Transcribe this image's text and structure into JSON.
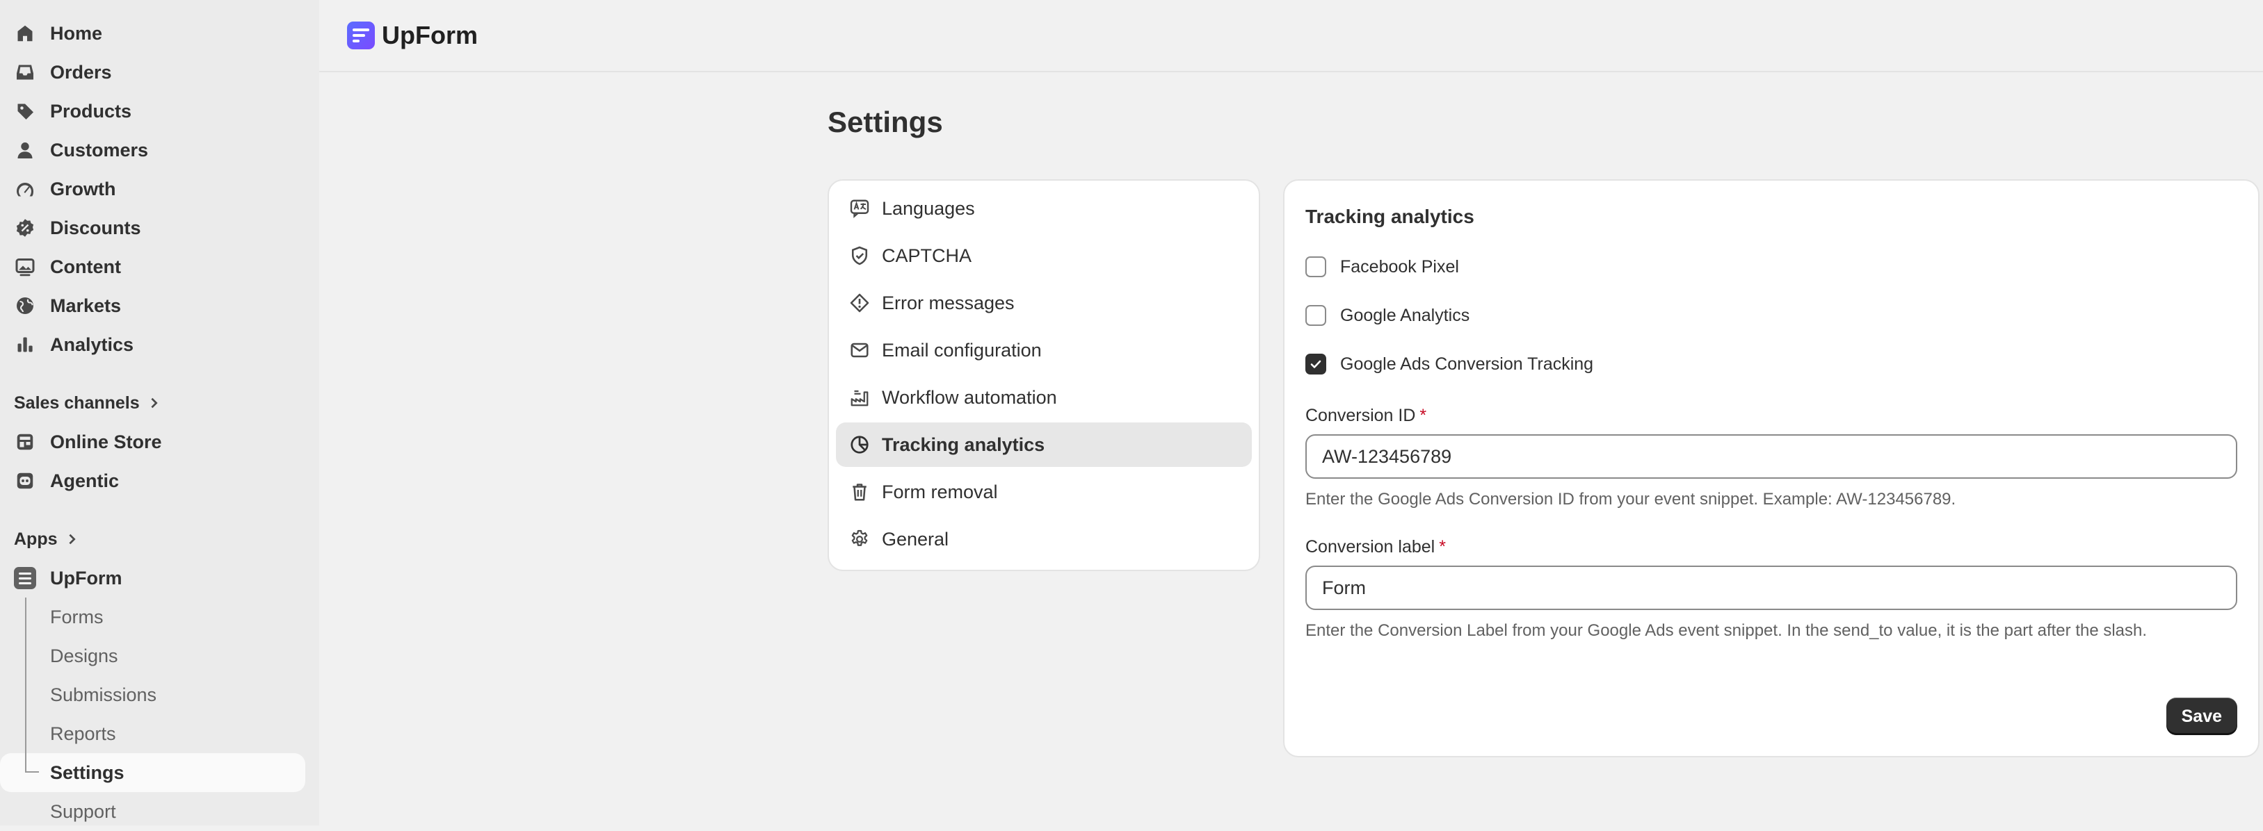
{
  "sidebar": {
    "items": [
      {
        "label": "Home",
        "icon": "home-icon"
      },
      {
        "label": "Orders",
        "icon": "inbox-icon"
      },
      {
        "label": "Products",
        "icon": "tag-icon"
      },
      {
        "label": "Customers",
        "icon": "person-icon"
      },
      {
        "label": "Growth",
        "icon": "gauge-icon"
      },
      {
        "label": "Discounts",
        "icon": "discount-icon"
      },
      {
        "label": "Content",
        "icon": "image-icon"
      },
      {
        "label": "Markets",
        "icon": "globe-icon"
      },
      {
        "label": "Analytics",
        "icon": "bar-chart-icon"
      }
    ],
    "sales_channels_label": "Sales channels",
    "channels": [
      {
        "label": "Online Store",
        "icon": "store-icon"
      },
      {
        "label": "Agentic",
        "icon": "robot-icon"
      }
    ],
    "apps_label": "Apps",
    "app": {
      "label": "UpForm",
      "icon": "upform-app-icon"
    },
    "app_sub_items": [
      {
        "label": "Forms"
      },
      {
        "label": "Designs"
      },
      {
        "label": "Submissions"
      },
      {
        "label": "Reports"
      },
      {
        "label": "Settings",
        "active": true
      },
      {
        "label": "Support"
      }
    ]
  },
  "header": {
    "brand": "UpForm",
    "brand_icon": "upform-logo-icon"
  },
  "page": {
    "title": "Settings"
  },
  "settings_menu": {
    "items": [
      {
        "label": "Languages",
        "icon": "translate-icon"
      },
      {
        "label": "CAPTCHA",
        "icon": "shield-check-icon"
      },
      {
        "label": "Error messages",
        "icon": "alert-diamond-icon"
      },
      {
        "label": "Email configuration",
        "icon": "email-icon"
      },
      {
        "label": "Workflow automation",
        "icon": "workflow-icon"
      },
      {
        "label": "Tracking analytics",
        "icon": "analytics-icon",
        "active": true
      },
      {
        "label": "Form removal",
        "icon": "trash-icon"
      },
      {
        "label": "General",
        "icon": "gear-icon"
      }
    ]
  },
  "tracking": {
    "title": "Tracking analytics",
    "options": [
      {
        "label": "Facebook Pixel",
        "checked": false
      },
      {
        "label": "Google Analytics",
        "checked": false
      },
      {
        "label": "Google Ads Conversion Tracking",
        "checked": true
      }
    ],
    "conversion_id": {
      "label": "Conversion ID",
      "required_mark": "*",
      "value": "AW-123456789",
      "help": "Enter the Google Ads Conversion ID from your event snippet. Example: AW-123456789."
    },
    "conversion_label": {
      "label": "Conversion label",
      "required_mark": "*",
      "value": "Form",
      "help": "Enter the Conversion Label from your Google Ads event snippet. In the send_to value, it is the part after the slash."
    },
    "save_label": "Save"
  },
  "colors": {
    "sidebar_bg": "#ebebeb",
    "page_bg": "#f1f1f1",
    "card_bg": "#ffffff",
    "primary_button": "#303030",
    "required": "#c70a24",
    "brand_gradient_start": "#5b6cff",
    "brand_gradient_end": "#7a4bff"
  }
}
